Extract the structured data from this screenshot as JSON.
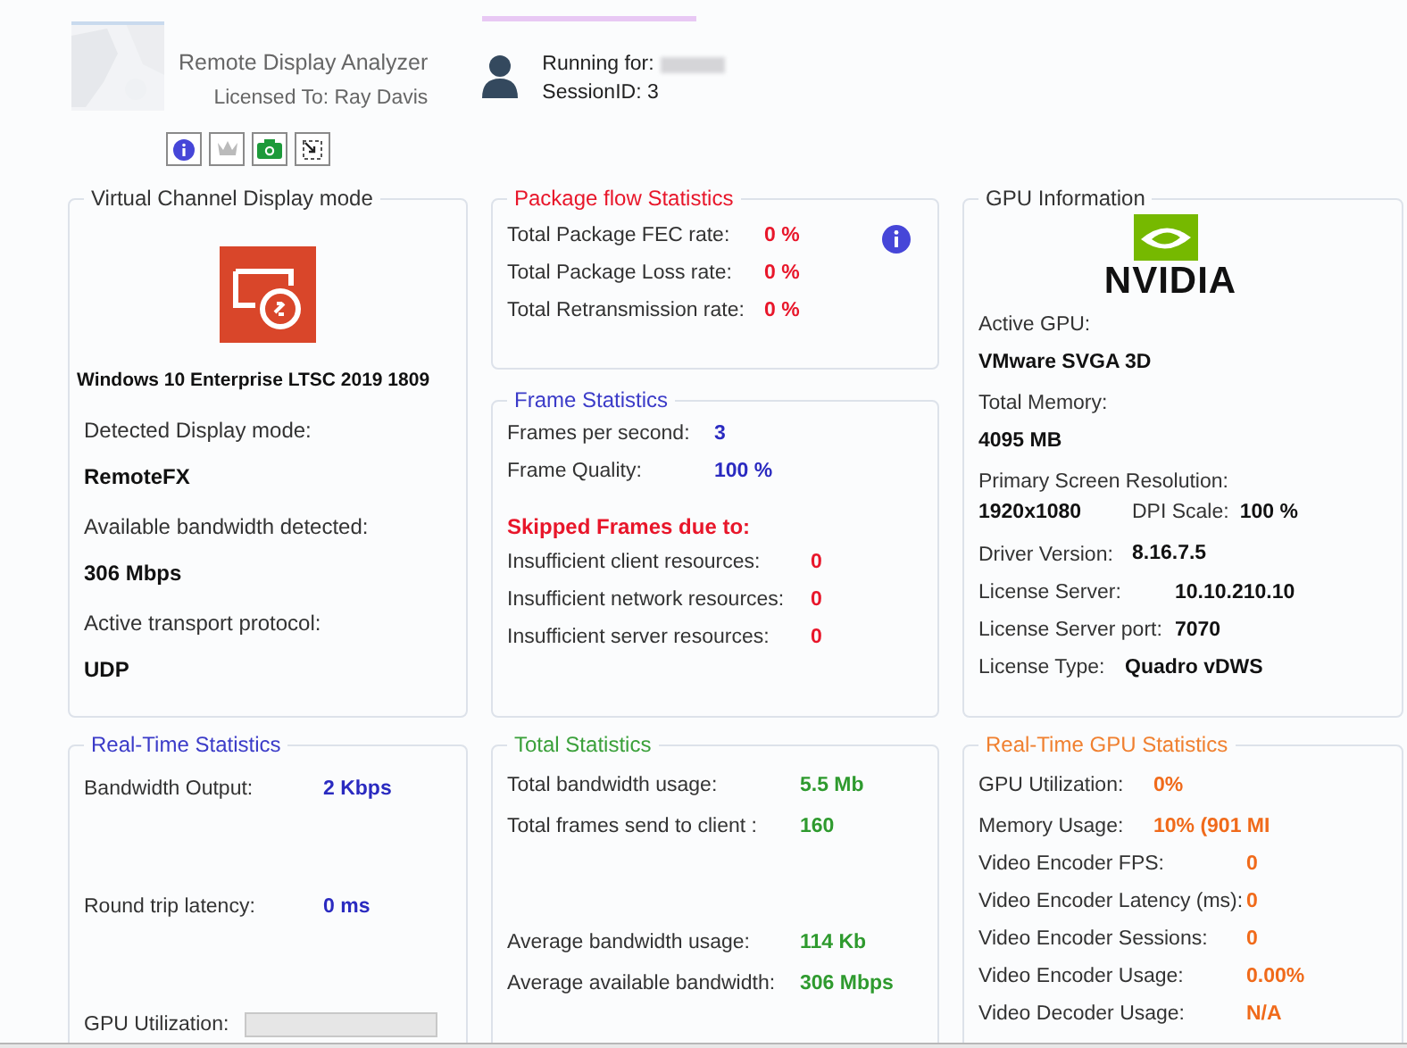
{
  "header": {
    "app_title": "Remote Display Analyzer",
    "licensed_to": "Licensed To: Ray Davis",
    "running_for": "Running for:",
    "session": "SessionID: 3"
  },
  "display_mode": {
    "title": "Virtual Channel Display mode",
    "os_name": "Windows 10 Enterprise LTSC 2019 1809",
    "fields": [
      {
        "label": "Detected Display mode:",
        "value": "RemoteFX"
      },
      {
        "label": "Available bandwidth detected:",
        "value": "306 Mbps"
      },
      {
        "label": "Active transport protocol:",
        "value": "UDP"
      }
    ]
  },
  "package_flow": {
    "title": "Package flow Statistics",
    "rows": [
      {
        "label": "Total Package FEC rate:",
        "value": "0 %"
      },
      {
        "label": "Total Package Loss rate:",
        "value": "0 %"
      },
      {
        "label": "Total Retransmission rate:",
        "value": "0 %"
      }
    ]
  },
  "frame_statistics": {
    "title": "Frame Statistics",
    "rows": [
      {
        "label": "Frames per second:",
        "value": "3"
      },
      {
        "label": "Frame Quality:",
        "value": "100 %"
      }
    ],
    "skipped_heading": "Skipped Frames due to:",
    "skipped_rows": [
      {
        "label": "Insufficient client resources:",
        "value": "0"
      },
      {
        "label": "Insufficient network resources:",
        "value": "0"
      },
      {
        "label": "Insufficient server resources:",
        "value": "0"
      }
    ]
  },
  "gpu_information": {
    "title": "GPU Information",
    "logo_text": "NVIDIA",
    "items": [
      {
        "kind": "stacked",
        "label": "Active GPU:",
        "value": "VMware SVGA 3D"
      },
      {
        "kind": "stacked",
        "label": "Total Memory:",
        "value": "4095 MB"
      },
      {
        "kind": "resolution",
        "label": "Primary Screen Resolution:",
        "value": "1920x1080",
        "dpi_label": "DPI Scale:",
        "dpi_value": "100 %"
      },
      {
        "kind": "inline",
        "label": "Driver Version:",
        "value": "8.16.7.5"
      },
      {
        "kind": "inline",
        "label": "License Server:",
        "value": "10.10.210.10"
      },
      {
        "kind": "inline",
        "label": "License Server port:",
        "value": "7070"
      },
      {
        "kind": "inline",
        "label": "License Type:",
        "value": "Quadro vDWS"
      }
    ]
  },
  "realtime_statistics": {
    "title": "Real-Time Statistics",
    "rows": [
      {
        "kind": "value",
        "label": "Bandwidth Output:",
        "value": "2 Kbps"
      },
      {
        "kind": "value",
        "label": "Round trip latency:",
        "value": "0 ms"
      },
      {
        "kind": "bar",
        "label": "GPU Utilization:",
        "level": 0
      }
    ]
  },
  "total_statistics": {
    "title": "Total Statistics",
    "rows": [
      {
        "label": "Total bandwidth usage:",
        "value": "5.5 Mb"
      },
      {
        "label": "Total frames send to client :",
        "value": "160"
      }
    ],
    "average_rows": [
      {
        "label": "Average bandwidth usage:",
        "value": "114 Kb"
      },
      {
        "label": "Average available bandwidth:",
        "value": "306 Mbps"
      }
    ]
  },
  "realtime_gpu_statistics": {
    "title": "Real-Time GPU Statistics",
    "rows": [
      {
        "label": "GPU Utilization:",
        "value": "0%"
      },
      {
        "label": "Memory Usage:",
        "value": "10% (901 MI"
      },
      {
        "label": "Video Encoder FPS:",
        "value": "0"
      },
      {
        "label": "Video Encoder Latency (ms):",
        "value": "0"
      },
      {
        "label": "Video Encoder Sessions:",
        "value": "0"
      },
      {
        "label": "Video Encoder Usage:",
        "value": "0.00%"
      },
      {
        "label": "Video Decoder Usage:",
        "value": "N/A"
      }
    ]
  }
}
